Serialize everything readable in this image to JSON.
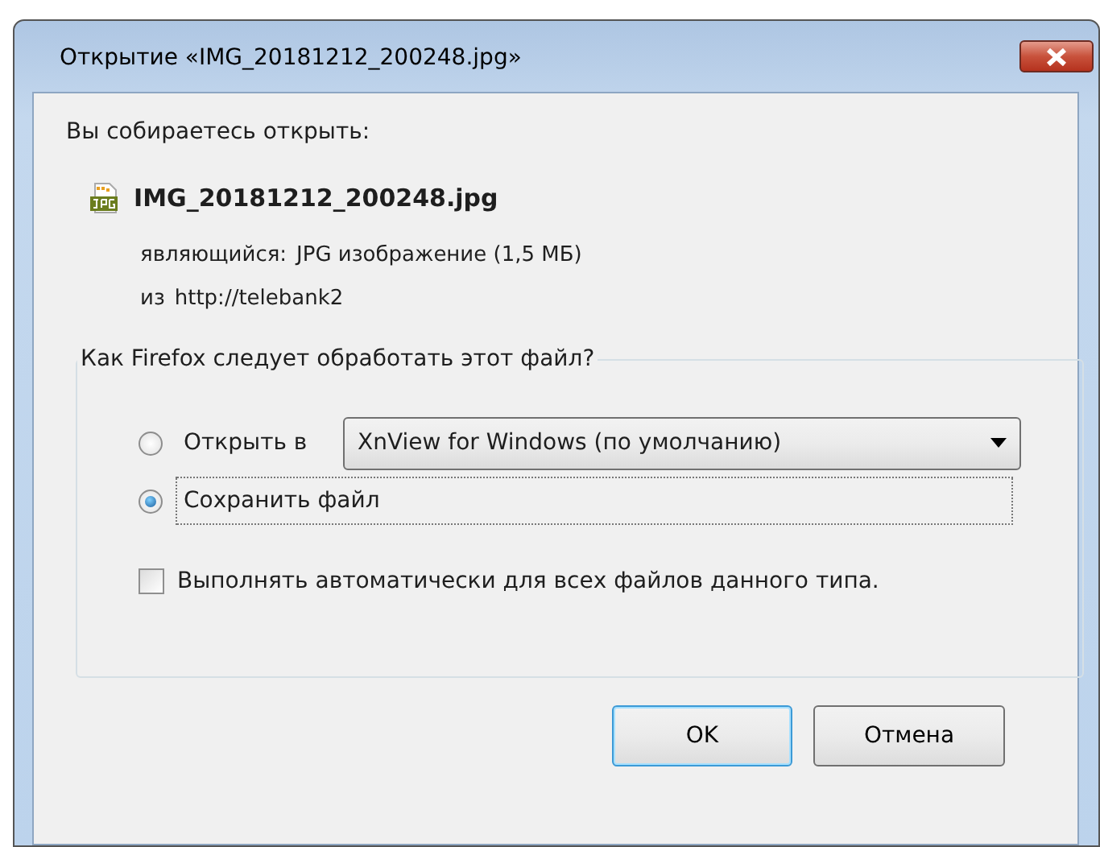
{
  "window": {
    "title": "Открытие «IMG_20181212_200248.jpg»"
  },
  "intro": "Вы собираетесь открыть:",
  "file": {
    "name": "IMG_20181212_200248.jpg",
    "type_label": "являющийся:",
    "type_value": "JPG изображение (1,5 МБ)",
    "from_label": "из",
    "from_value": "http://telebank2"
  },
  "group": {
    "legend": "Как Firefox следует обработать этот файл?",
    "options": [
      {
        "label": "Открыть в",
        "selected": false,
        "focused": false,
        "app": "XnView for Windows (по умолчанию)"
      },
      {
        "label": "Сохранить файл",
        "selected": true,
        "focused": true
      }
    ],
    "auto": {
      "label": "Выполнять автоматически для всех файлов данного типа.",
      "checked": false
    }
  },
  "buttons": [
    {
      "label": "OK",
      "default": true
    },
    {
      "label": "Отмена",
      "default": false
    }
  ]
}
